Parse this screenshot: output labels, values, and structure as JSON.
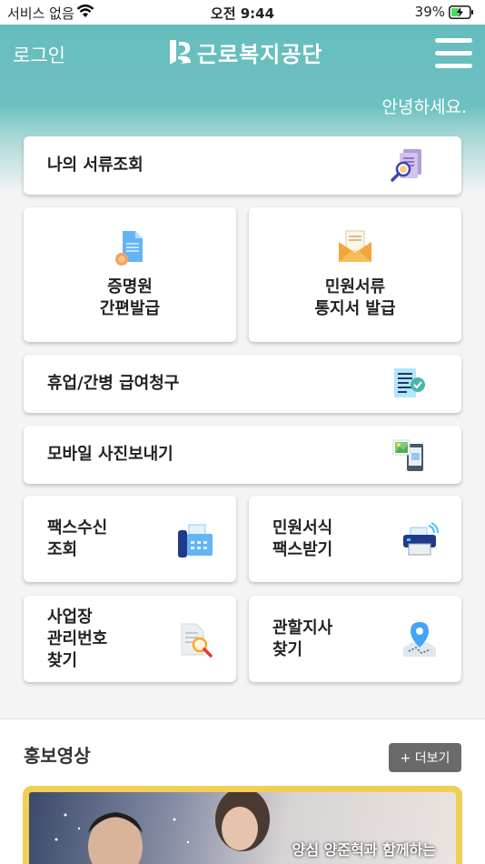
{
  "status_bar": {
    "carrier": "서비스 없음",
    "time": "오전 9:44",
    "battery": "39%"
  },
  "header": {
    "login": "로그인",
    "logo_text": "근로복지공단",
    "greeting": "안녕하세요."
  },
  "menu": {
    "my_documents": "나의 서류조회",
    "certificate": [
      "증명원",
      "간편발급"
    ],
    "notice": [
      "민원서류",
      "통지서 발급"
    ],
    "claim": "휴업/간병 급여청구",
    "photo": "모바일 사진보내기",
    "fax_receive": [
      "팩스수신",
      "조회"
    ],
    "form_fax": [
      "민원서식",
      "팩스받기"
    ],
    "business_number": [
      "사업장",
      "관리번호",
      "찾기"
    ],
    "branch": [
      "관할지사",
      "찾기"
    ]
  },
  "promo": {
    "title": "홍보영상",
    "more": "+ 더보기",
    "caption": "양심 양준혁과 함께하는"
  },
  "colors": {
    "header": "#66bcbd",
    "card": "#ffffff",
    "promo_border": "#f1cf56",
    "more_button": "#6a6a6a"
  }
}
